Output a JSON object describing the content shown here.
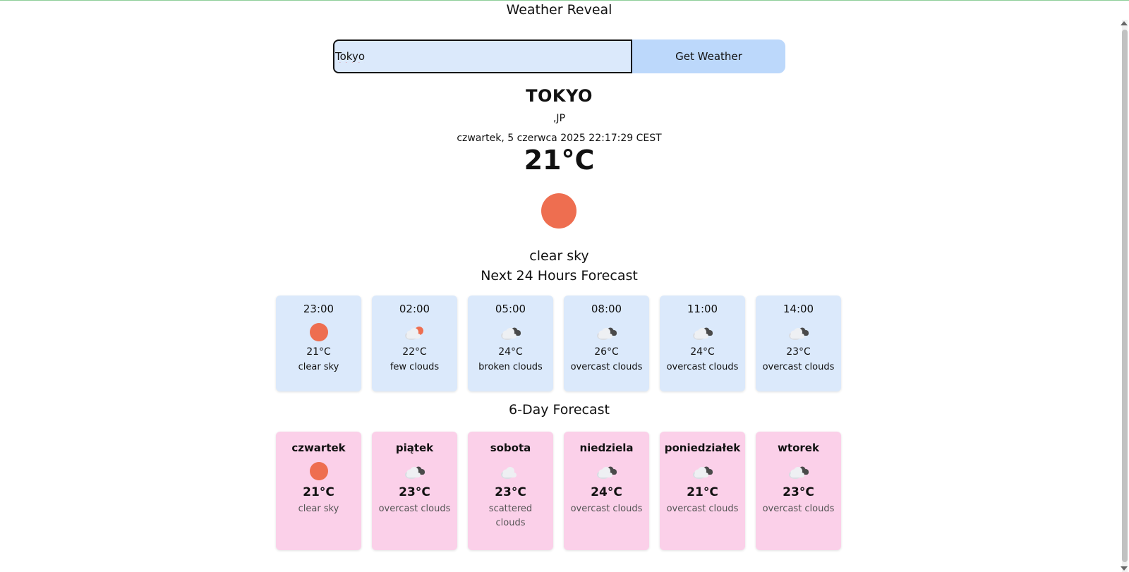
{
  "app": {
    "title": "Weather Reveal"
  },
  "search": {
    "value": "Tokyo",
    "button_label": "Get Weather"
  },
  "current": {
    "city": "TOKYO",
    "country": ",JP",
    "datetime": "czwartek, 5 czerwca 2025 22:17:29 CEST",
    "temperature": "21°C",
    "description": "clear sky",
    "icon": "sun-icon",
    "sun_color": "#ee6e50"
  },
  "hourly": {
    "title": "Next 24 Hours Forecast",
    "items": [
      {
        "time": "23:00",
        "temp": "21°C",
        "desc": "clear sky",
        "icon": "sun-icon"
      },
      {
        "time": "02:00",
        "temp": "22°C",
        "desc": "few clouds",
        "icon": "few-clouds-icon"
      },
      {
        "time": "05:00",
        "temp": "24°C",
        "desc": "broken clouds",
        "icon": "broken-clouds-icon"
      },
      {
        "time": "08:00",
        "temp": "26°C",
        "desc": "overcast clouds",
        "icon": "overcast-clouds-icon"
      },
      {
        "time": "11:00",
        "temp": "24°C",
        "desc": "overcast clouds",
        "icon": "overcast-clouds-icon"
      },
      {
        "time": "14:00",
        "temp": "23°C",
        "desc": "overcast clouds",
        "icon": "overcast-clouds-icon"
      }
    ]
  },
  "daily": {
    "title": "6-Day Forecast",
    "items": [
      {
        "day": "czwartek",
        "temp": "21°C",
        "desc": "clear sky",
        "icon": "sun-icon"
      },
      {
        "day": "piątek",
        "temp": "23°C",
        "desc": "overcast clouds",
        "icon": "overcast-clouds-icon"
      },
      {
        "day": "sobota",
        "temp": "23°C",
        "desc": "scattered clouds",
        "icon": "scattered-clouds-icon"
      },
      {
        "day": "niedziela",
        "temp": "24°C",
        "desc": "overcast clouds",
        "icon": "overcast-clouds-icon"
      },
      {
        "day": "poniedziałek",
        "temp": "21°C",
        "desc": "overcast clouds",
        "icon": "overcast-clouds-icon"
      },
      {
        "day": "wtorek",
        "temp": "23°C",
        "desc": "overcast clouds",
        "icon": "overcast-clouds-icon"
      }
    ]
  },
  "colors": {
    "hourly_card": "#dbe9fb",
    "daily_card": "#fbd0e9",
    "button": "#bcd8fb"
  }
}
